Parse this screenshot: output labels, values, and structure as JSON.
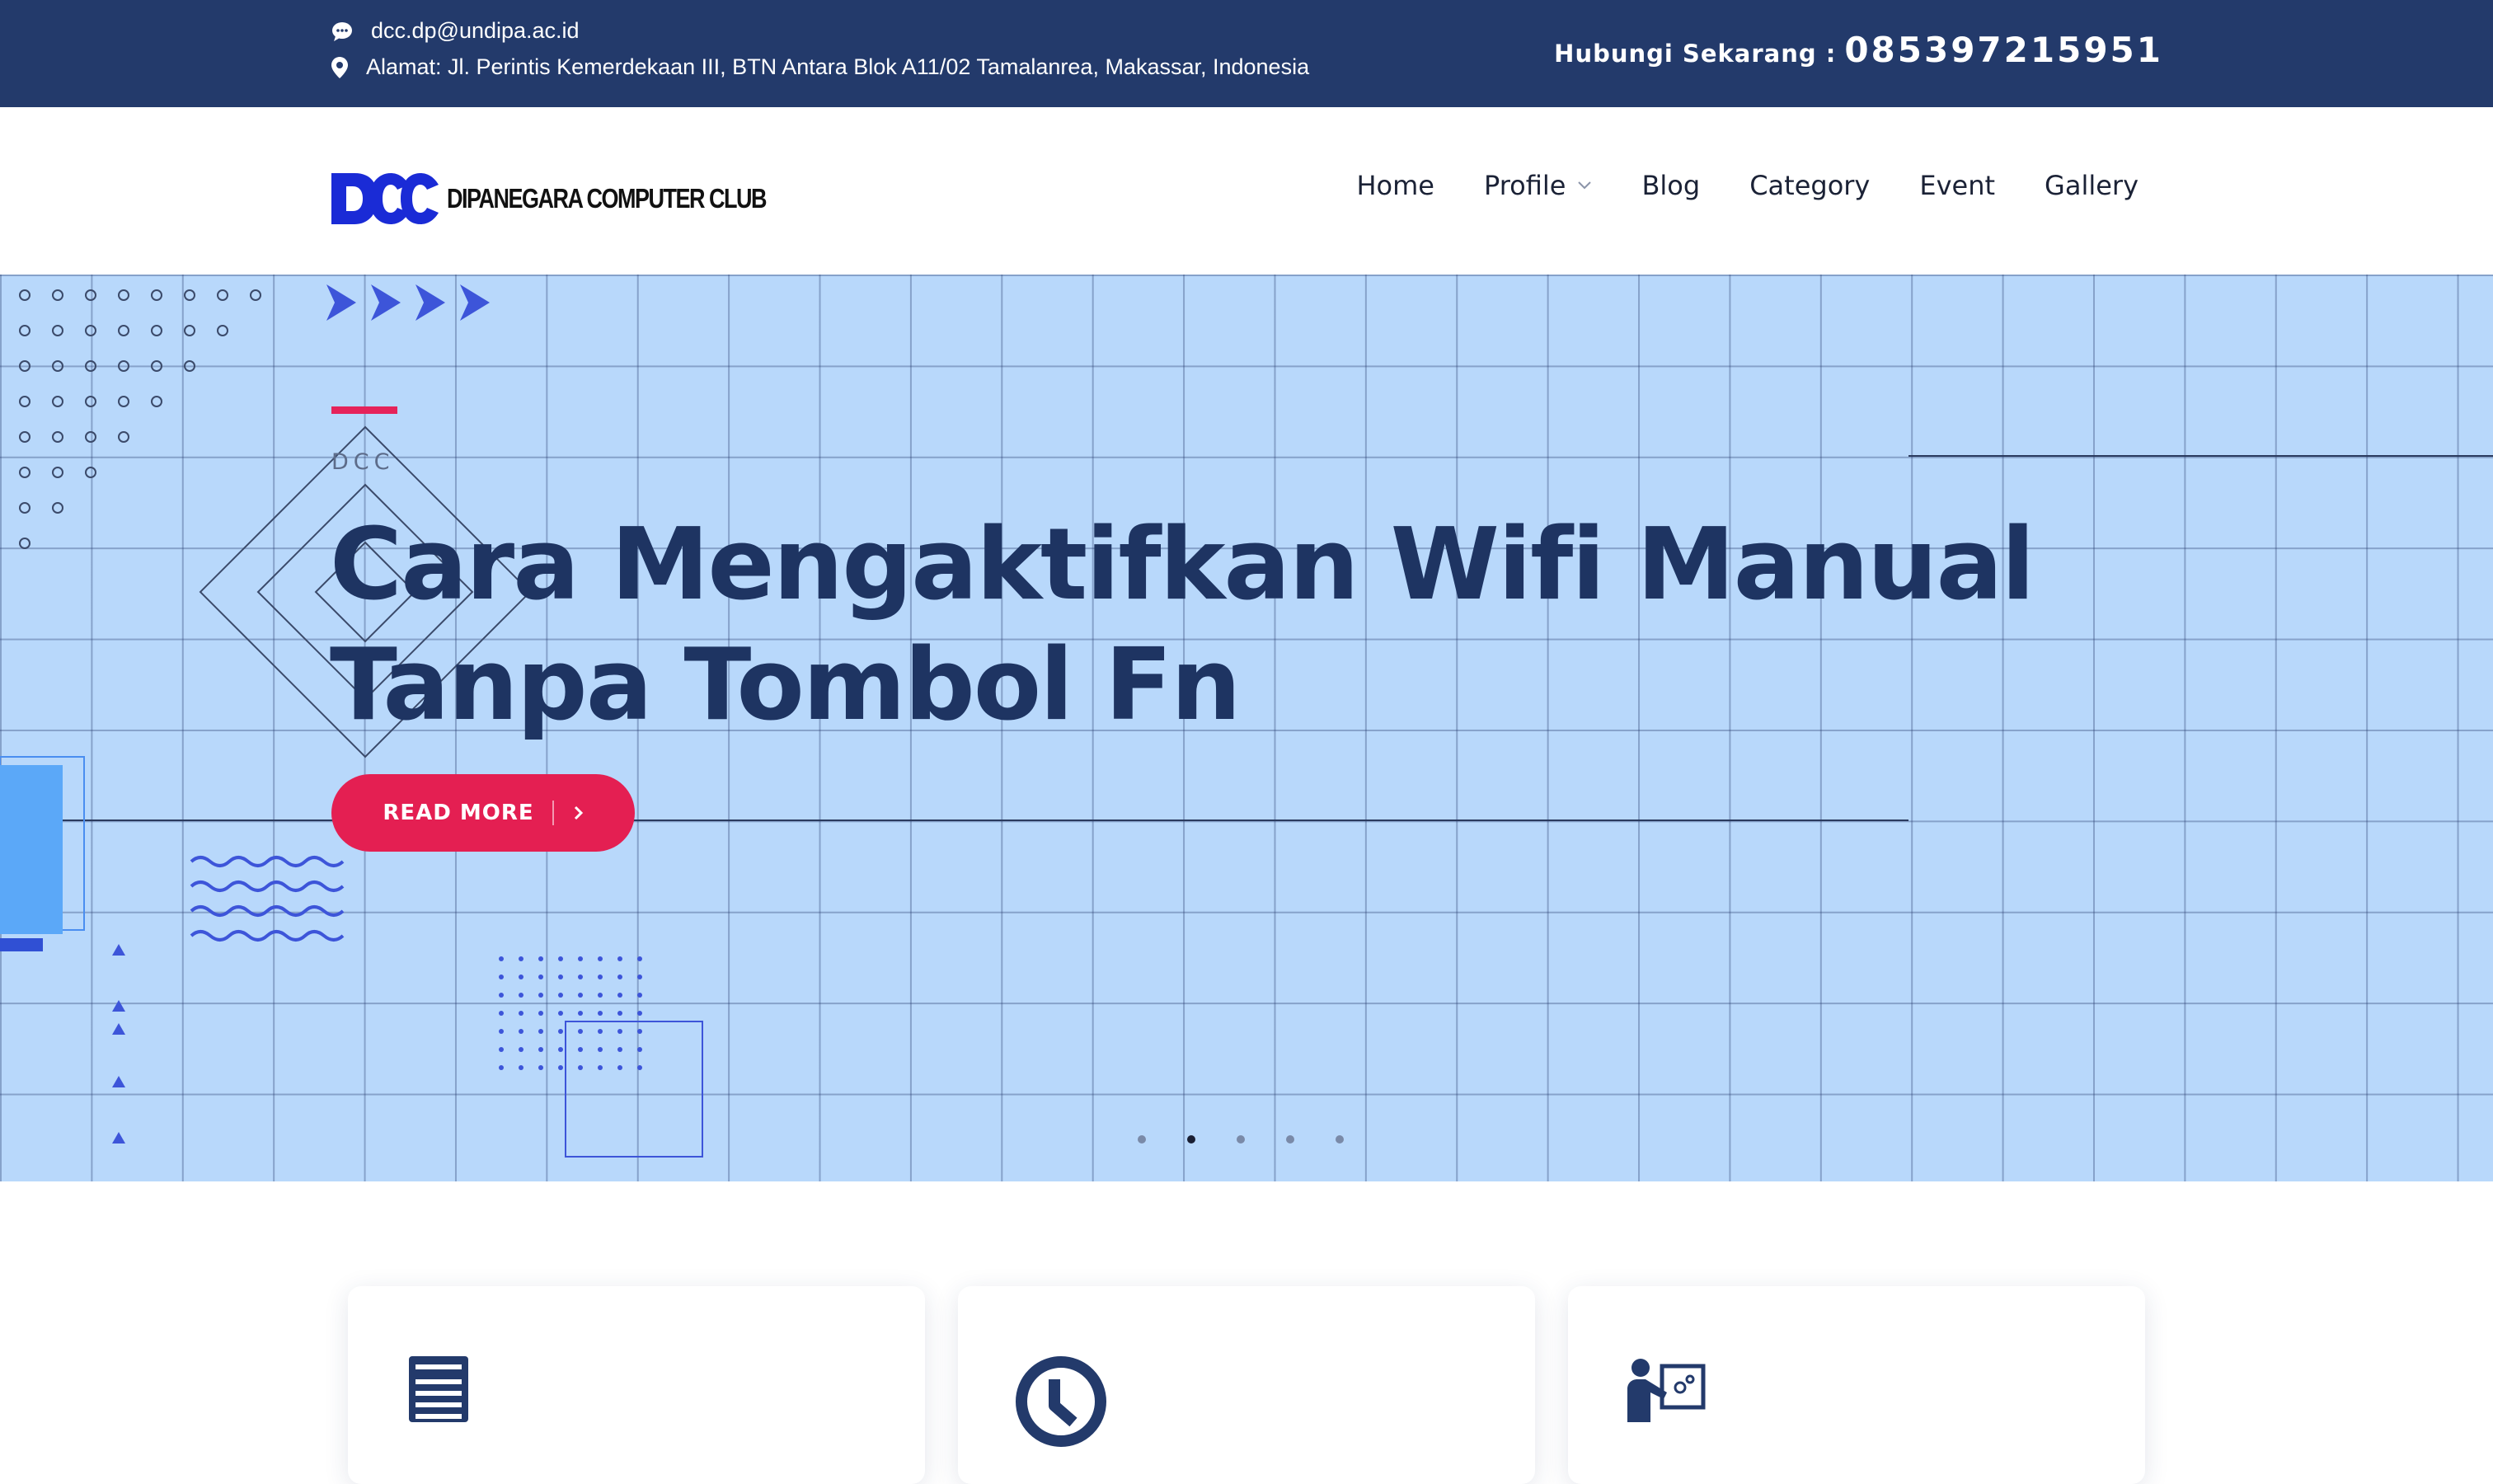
{
  "topbar": {
    "email": "dcc.dp@undipa.ac.id",
    "address": "Alamat: Jl. Perintis Kemerdekaan III, BTN Antara Blok A11/02 Tamalanrea, Makassar, Indonesia",
    "contact_label": "Hubungi Sekarang :",
    "phone": "085397215951",
    "email_icon": "chat-bubble-icon",
    "address_icon": "map-pin-icon"
  },
  "header": {
    "logo_mark": "DCC",
    "logo_text": "DIPANEGARA COMPUTER CLUB",
    "nav": [
      {
        "label": "Home"
      },
      {
        "label": "Profile",
        "icon": "chevron-down-icon"
      },
      {
        "label": "Blog"
      },
      {
        "label": "Category"
      },
      {
        "label": "Event"
      },
      {
        "label": "Gallery"
      }
    ]
  },
  "hero": {
    "eyebrow": "DCC",
    "title": "Cara Mengaktifkan Wifi Manual Tanpa Tombol Fn",
    "button_label": "READ MORE",
    "button_icon": "chevron-right-icon",
    "slides": 5,
    "active_slide": 2
  },
  "colors": {
    "topbar": "#233a6b",
    "hero_bg": "#b8d8fb",
    "accent": "#e41f52",
    "title": "#1e3462",
    "logo_blue": "#1a2bd6"
  },
  "cards": [
    {
      "icon": "document-list-icon"
    },
    {
      "icon": "clock-icon"
    },
    {
      "icon": "presenter-board-icon"
    }
  ]
}
